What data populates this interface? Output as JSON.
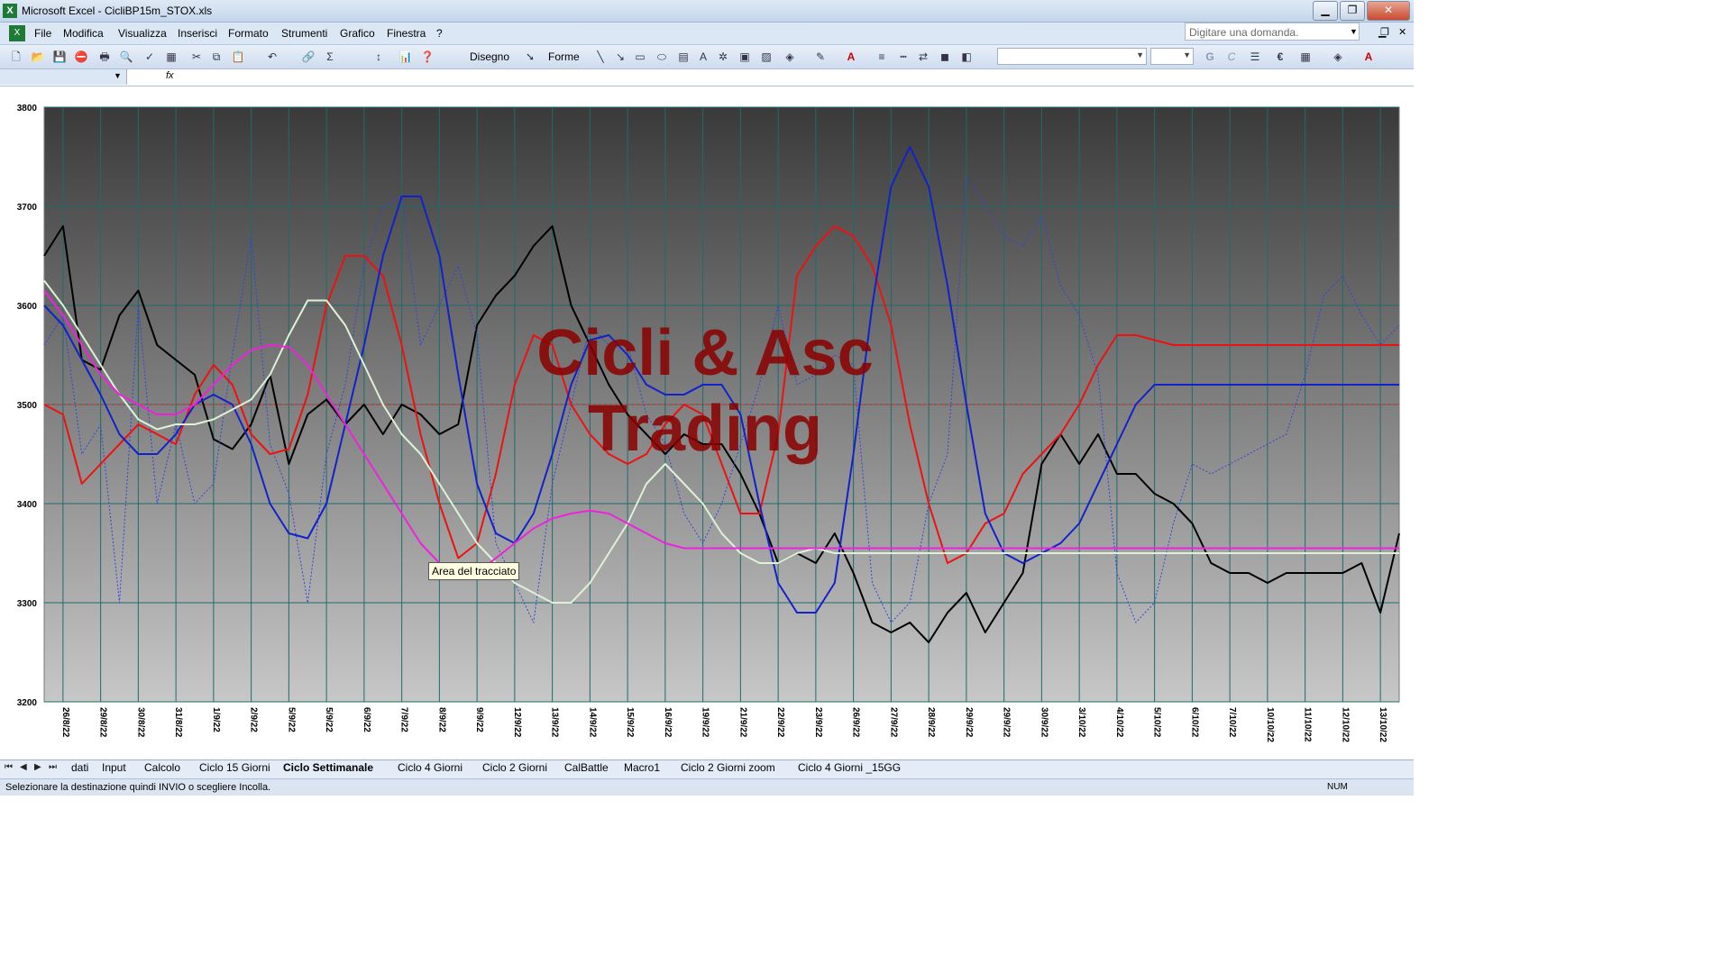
{
  "window": {
    "title": "Microsoft Excel - CicliBP15m_STOX.xls",
    "controls": {
      "minimize": "▁",
      "restore": "❐",
      "close": "✕"
    }
  },
  "menu": {
    "items": [
      "File",
      "Modifica",
      "Visualizza",
      "Inserisci",
      "Formato",
      "Strumenti",
      "Grafico",
      "Finestra",
      "?"
    ],
    "help_placeholder": "Digitare una domanda.",
    "doc_controls": [
      "▁",
      "❐",
      "✕"
    ]
  },
  "toolbar": {
    "disegno_label": "Disegno",
    "forme_label": "Forme",
    "sigma": "Σ",
    "euro": "€",
    "bold": "G",
    "italic": "C"
  },
  "formula": {
    "fx": "fx"
  },
  "chart_data": {
    "type": "line",
    "watermark": [
      "Cicli & Asc",
      "Trading"
    ],
    "ylim": [
      3200,
      3800
    ],
    "yticks": [
      3200,
      3300,
      3400,
      3500,
      3600,
      3700,
      3800
    ],
    "xticks": [
      "26/8/22",
      "29/8/22",
      "30/8/22",
      "31/8/22",
      "1/9/22",
      "2/9/22",
      "5/9/22",
      "5/9/22",
      "6/9/22",
      "7/9/22",
      "8/9/22",
      "9/9/22",
      "12/9/22",
      "13/9/22",
      "14/9/22",
      "15/9/22",
      "16/9/22",
      "19/9/22",
      "21/9/22",
      "22/9/22",
      "23/9/22",
      "26/9/22",
      "27/9/22",
      "28/9/22",
      "29/9/22",
      "29/9/22",
      "30/9/22",
      "3/10/22",
      "4/10/22",
      "5/10/22",
      "6/10/22",
      "7/10/22",
      "10/10/22",
      "11/10/22",
      "12/10/22",
      "13/10/22"
    ],
    "reference_line": 3500,
    "grid": true,
    "x_positions": [
      0,
      2,
      4,
      6,
      8,
      10,
      12,
      14,
      16,
      18,
      20,
      22,
      24,
      26,
      28,
      30,
      32,
      34,
      36,
      38,
      40,
      42,
      44,
      46,
      48,
      50,
      52,
      54,
      56,
      58,
      60,
      62,
      64,
      66,
      68,
      70,
      72
    ],
    "series": [
      {
        "color": "#000000",
        "style": "solid",
        "values": [
          3650,
          3680,
          3545,
          3535,
          3590,
          3615,
          3560,
          3545,
          3530,
          3465,
          3455,
          3480,
          3530,
          3440,
          3490,
          3505,
          3480,
          3500,
          3470,
          3500,
          3490,
          3470,
          3480,
          3580,
          3610,
          3630,
          3660,
          3680,
          3600,
          3560,
          3520,
          3490,
          3470,
          3450,
          3470,
          3460,
          3460,
          3430,
          3390,
          3340,
          3350,
          3340,
          3370,
          3330,
          3280,
          3270,
          3280,
          3260,
          3290,
          3310,
          3270,
          3300,
          3330,
          3440,
          3470,
          3440,
          3470,
          3430,
          3430,
          3410,
          3400,
          3380,
          3340,
          3330,
          3330,
          3320,
          3330,
          3330,
          3330,
          3330,
          3340,
          3290,
          3370
        ]
      },
      {
        "color": "#3344dd",
        "style": "dashed",
        "values": [
          3560,
          3590,
          3450,
          3480,
          3300,
          3600,
          3400,
          3480,
          3400,
          3420,
          3550,
          3670,
          3460,
          3410,
          3300,
          3450,
          3520,
          3640,
          3700,
          3710,
          3560,
          3600,
          3640,
          3570,
          3360,
          3320,
          3280,
          3420,
          3500,
          3580,
          3560,
          3560,
          3490,
          3460,
          3390,
          3360,
          3400,
          3460,
          3520,
          3600,
          3520,
          3530,
          3550,
          3540,
          3320,
          3280,
          3300,
          3400,
          3450,
          3730,
          3700,
          3670,
          3660,
          3690,
          3620,
          3590,
          3530,
          3330,
          3280,
          3300,
          3380,
          3440,
          3430,
          3440,
          3450,
          3460,
          3470,
          3530,
          3610,
          3630,
          3590,
          3560,
          3580
        ]
      },
      {
        "color": "#ee1111",
        "style": "solid",
        "values": [
          3500,
          3490,
          3420,
          3440,
          3460,
          3480,
          3470,
          3460,
          3510,
          3540,
          3520,
          3470,
          3450,
          3455,
          3510,
          3600,
          3650,
          3650,
          3630,
          3560,
          3470,
          3400,
          3345,
          3360,
          3430,
          3520,
          3570,
          3560,
          3500,
          3470,
          3450,
          3440,
          3450,
          3480,
          3500,
          3490,
          3440,
          3390,
          3390,
          3470,
          3630,
          3660,
          3680,
          3670,
          3640,
          3580,
          3480,
          3400,
          3340,
          3350,
          3380,
          3390,
          3430,
          3450,
          3470,
          3500,
          3540,
          3570,
          3570,
          3565,
          3560,
          3560,
          3560,
          3560,
          3560,
          3560,
          3560,
          3560,
          3560,
          3560,
          3560,
          3560,
          3560
        ]
      },
      {
        "color": "#1122cc",
        "style": "solid",
        "values": [
          3600,
          3580,
          3545,
          3510,
          3470,
          3450,
          3450,
          3470,
          3500,
          3510,
          3500,
          3460,
          3400,
          3370,
          3365,
          3400,
          3480,
          3560,
          3650,
          3710,
          3710,
          3650,
          3530,
          3420,
          3370,
          3360,
          3390,
          3450,
          3520,
          3565,
          3570,
          3550,
          3520,
          3510,
          3510,
          3520,
          3520,
          3490,
          3400,
          3320,
          3290,
          3290,
          3320,
          3450,
          3600,
          3720,
          3760,
          3720,
          3620,
          3500,
          3390,
          3350,
          3340,
          3350,
          3360,
          3380,
          3420,
          3460,
          3500,
          3520,
          3520,
          3520,
          3520,
          3520,
          3520,
          3520,
          3520,
          3520,
          3520,
          3520,
          3520,
          3520,
          3520
        ]
      },
      {
        "color": "#ddf2d6",
        "style": "solid",
        "values": [
          3625,
          3600,
          3570,
          3540,
          3510,
          3485,
          3475,
          3480,
          3480,
          3485,
          3495,
          3505,
          3530,
          3570,
          3605,
          3605,
          3580,
          3540,
          3500,
          3470,
          3450,
          3420,
          3390,
          3360,
          3340,
          3320,
          3310,
          3300,
          3300,
          3320,
          3350,
          3380,
          3420,
          3440,
          3420,
          3400,
          3370,
          3350,
          3340,
          3340,
          3350,
          3355,
          3350,
          3350,
          3350,
          3350,
          3350,
          3350,
          3350,
          3350,
          3350,
          3350,
          3350,
          3350,
          3350,
          3350,
          3350,
          3350,
          3350,
          3350,
          3350,
          3350,
          3350,
          3350,
          3350,
          3350,
          3350,
          3350,
          3350,
          3350,
          3350,
          3350,
          3350
        ]
      },
      {
        "color": "#ee22dd",
        "style": "solid",
        "values": [
          3615,
          3590,
          3560,
          3530,
          3510,
          3500,
          3490,
          3490,
          3500,
          3520,
          3540,
          3555,
          3560,
          3558,
          3540,
          3510,
          3480,
          3450,
          3420,
          3390,
          3360,
          3340,
          3325,
          3330,
          3345,
          3360,
          3375,
          3385,
          3390,
          3393,
          3390,
          3380,
          3370,
          3360,
          3355,
          3355,
          3355,
          3355,
          3355,
          3355,
          3355,
          3355,
          3355,
          3355,
          3355,
          3355,
          3355,
          3355,
          3355,
          3355,
          3355,
          3355,
          3355,
          3355,
          3355,
          3355,
          3355,
          3355,
          3355,
          3355,
          3355,
          3355,
          3355,
          3355,
          3355,
          3355,
          3355,
          3355,
          3355,
          3355,
          3355,
          3355,
          3355
        ]
      }
    ]
  },
  "tooltip": "Area del tracciato",
  "sheets": {
    "tabs": [
      "dati",
      "Input",
      "Calcolo",
      "Ciclo 15 Giorni",
      "Ciclo Settimanale",
      "Ciclo 4 Giorni",
      "Ciclo 2 Giorni",
      "CalBattle",
      "Macro1",
      "Ciclo 2 Giorni zoom",
      "Ciclo 4 Giorni _15GG"
    ],
    "active": "Ciclo Settimanale",
    "nav": [
      "⏮",
      "◀",
      "▶",
      "⏭"
    ]
  },
  "status": {
    "message": "Selezionare la destinazione quindi INVIO o scegliere Incolla.",
    "num": "NUM"
  }
}
